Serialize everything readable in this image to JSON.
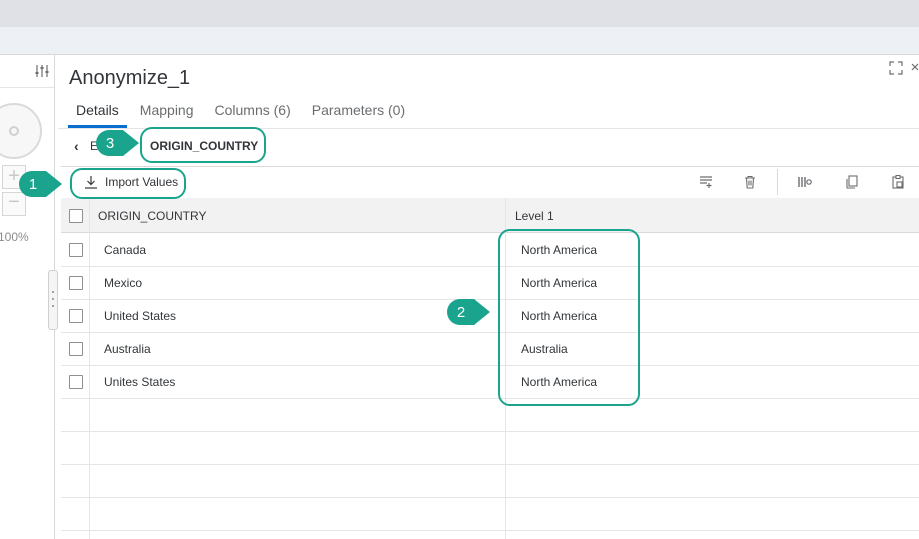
{
  "editor": {
    "title": "Anonymize_1",
    "tabs": [
      {
        "label": "Details",
        "active": true
      },
      {
        "label": "Mapping",
        "active": false
      },
      {
        "label": "Columns (6)",
        "active": false
      },
      {
        "label": "Parameters (0)",
        "active": false
      }
    ],
    "breadcrumb": {
      "partial": "E",
      "current": "ORIGIN_COUNTRY"
    }
  },
  "left_pane": {
    "zoom": "100%"
  },
  "toolbar": {
    "import_label": "Import Values"
  },
  "table": {
    "columns": [
      "ORIGIN_COUNTRY",
      "Level 1"
    ],
    "rows": [
      [
        "Canada",
        "North America"
      ],
      [
        "Mexico",
        "North America"
      ],
      [
        "United States",
        "North America"
      ],
      [
        "Australia",
        "Australia"
      ],
      [
        "Unites States",
        "North America"
      ]
    ]
  },
  "callouts": [
    "1",
    "2",
    "3"
  ],
  "colors": {
    "accent": "#0a6ed1",
    "callout": "#1aa48d"
  }
}
